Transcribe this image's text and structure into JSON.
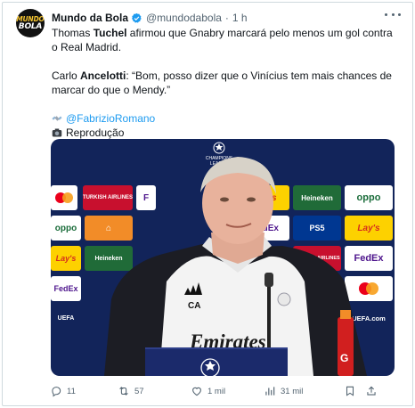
{
  "tweet": {
    "author_name": "Mundo da Bola",
    "handle": "@mundodabola",
    "separator": "·",
    "time": "1 h",
    "avatar_text": [
      "MUNDO",
      "BOLA"
    ],
    "line1_pre": "Thomas ",
    "line1_bold": "Tuchel",
    "line1_post": " afirmou que Gnabry marcará pelo menos um gol contra o Real Madrid.",
    "line2_pre": "Carlo ",
    "line2_bold": "Ancelotti",
    "line2_post": ": “Bom, posso dizer que o Vinícius tem mais chances de marcar do que o Mendy.”",
    "credit_link": "@FabrizioRomano",
    "credit_source": "Reprodução"
  },
  "media": {
    "ucl_text": "CHAMPIONS LEAGUE",
    "sponsors": [
      "TURKISH AIRLINES",
      "FedEx",
      "Lay's",
      "Heineken",
      "oppo",
      "PS5",
      "UEFA.com"
    ],
    "shirt_badge": "CA",
    "shirt_sponsor": "Emirates FLY BETTER"
  },
  "actions": {
    "replies": "11",
    "reposts": "57",
    "likes": "1 mil",
    "views": "31 mil"
  },
  "colors": {
    "accent": "#1d9bf0",
    "muted": "#536471",
    "text": "#0f1419",
    "backdrop": "#12245a"
  }
}
